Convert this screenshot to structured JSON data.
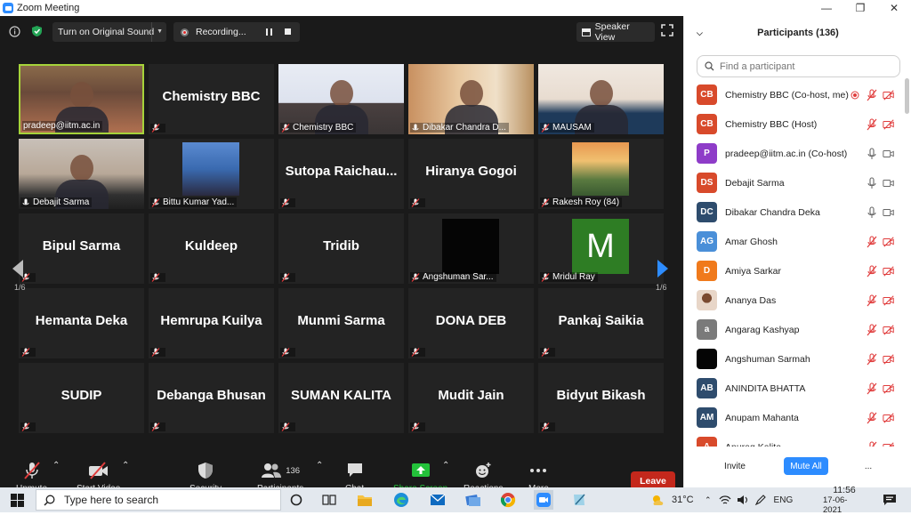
{
  "window": {
    "title": "Zoom Meeting"
  },
  "topbar": {
    "original_sound_label": "Turn on Original Sound",
    "recording_label": "Recording...",
    "speaker_view_label": "Speaker View"
  },
  "tiles": [
    {
      "name": "pradeep@iitm.ac.in",
      "kind": "video",
      "muted": false,
      "active": true
    },
    {
      "name": "Chemistry BBC",
      "kind": "name",
      "muted": true
    },
    {
      "name": "Chemistry BBC",
      "kind": "video",
      "muted": true
    },
    {
      "name": "Dibakar Chandra D...",
      "kind": "video",
      "muted": false
    },
    {
      "name": "MAUSAM",
      "kind": "video",
      "muted": true
    },
    {
      "name": "Debajit Sarma",
      "kind": "video",
      "muted": false
    },
    {
      "name": "Bittu Kumar Yad...",
      "kind": "photo",
      "muted": true
    },
    {
      "name": "Sutopa Raichau...",
      "kind": "name",
      "muted": true
    },
    {
      "name": "Hiranya Gogoi",
      "kind": "name",
      "muted": true
    },
    {
      "name": "Rakesh Roy (84)",
      "kind": "photo",
      "muted": true
    },
    {
      "name": "Bipul Sarma",
      "kind": "name",
      "muted": true
    },
    {
      "name": "Kuldeep",
      "kind": "name",
      "muted": true
    },
    {
      "name": "Tridib",
      "kind": "name",
      "muted": true
    },
    {
      "name": "Angshuman Sar...",
      "kind": "black",
      "muted": true
    },
    {
      "name": "Mridul Ray",
      "kind": "letter",
      "letter": "M",
      "muted": true
    },
    {
      "name": "Hemanta Deka",
      "kind": "name",
      "muted": true
    },
    {
      "name": "Hemrupa Kuilya",
      "kind": "name",
      "muted": true
    },
    {
      "name": "Munmi Sarma",
      "kind": "name",
      "muted": true
    },
    {
      "name": "DONA DEB",
      "kind": "name",
      "muted": true
    },
    {
      "name": "Pankaj Saikia",
      "kind": "name",
      "muted": true
    },
    {
      "name": "SUDIP",
      "kind": "name",
      "muted": true
    },
    {
      "name": "Debanga Bhusan",
      "kind": "name",
      "muted": true
    },
    {
      "name": "SUMAN KALITA",
      "kind": "name",
      "muted": true
    },
    {
      "name": "Mudit Jain",
      "kind": "name",
      "muted": true
    },
    {
      "name": "Bidyut Bikash",
      "kind": "name",
      "muted": true
    }
  ],
  "pagination": {
    "left": "1/6",
    "right": "1/6"
  },
  "toolbar": {
    "unmute": "Unmute",
    "start_video": "Start Video",
    "security": "Security",
    "participants": "Participants",
    "participants_count": "136",
    "chat": "Chat",
    "share_screen": "Share Screen",
    "reactions": "Reactions",
    "more": "More",
    "leave": "Leave"
  },
  "panel": {
    "title": "Participants (136)",
    "search_placeholder": "Find a participant",
    "participants": [
      {
        "initials": "CB",
        "name": "Chemistry BBC (Co-host, me)",
        "color": "#d84a2b",
        "rec": true,
        "mic": "muted",
        "cam": "off"
      },
      {
        "initials": "CB",
        "name": "Chemistry BBC (Host)",
        "color": "#d84a2b",
        "mic": "muted",
        "cam": "off"
      },
      {
        "initials": "P",
        "name": "pradeep@iitm.ac.in (Co-host)",
        "color": "#8e3cc8",
        "mic": "on",
        "cam": "on"
      },
      {
        "initials": "DS",
        "name": "Debajit Sarma",
        "color": "#d84a2b",
        "mic": "on",
        "cam": "on"
      },
      {
        "initials": "DC",
        "name": "Dibakar Chandra Deka",
        "color": "#2e4c6d",
        "mic": "on",
        "cam": "on"
      },
      {
        "initials": "AG",
        "name": "Amar Ghosh",
        "color": "#4a8fd8",
        "mic": "muted",
        "cam": "off"
      },
      {
        "initials": "D",
        "name": "Amiya Sarkar",
        "color": "#f07a1c",
        "mic": "muted",
        "cam": "off"
      },
      {
        "initials": "",
        "name": "Ananya Das",
        "color": "#e8d6c8",
        "photo": true,
        "mic": "muted",
        "cam": "off"
      },
      {
        "initials": "a",
        "name": "Angarag Kashyap",
        "color": "#7a7a7a",
        "mic": "muted",
        "cam": "off"
      },
      {
        "initials": "",
        "name": "Angshuman Sarmah",
        "color": "#050505",
        "mic": "muted",
        "cam": "off"
      },
      {
        "initials": "AB",
        "name": "ANINDITA BHATTA",
        "color": "#2e4c6d",
        "mic": "muted",
        "cam": "off"
      },
      {
        "initials": "AM",
        "name": "Anupam Mahanta",
        "color": "#2e4c6d",
        "mic": "muted",
        "cam": "off"
      },
      {
        "initials": "A",
        "name": "Anurag Kalita",
        "color": "#d84a2b",
        "mic": "muted",
        "cam": "off"
      }
    ],
    "invite": "Invite",
    "mute_all": "Mute All",
    "more": "..."
  },
  "taskbar": {
    "search_placeholder": "Type here to search",
    "temperature": "31°C",
    "language": "ENG",
    "time": "11:56",
    "date": "17-06-2021"
  }
}
